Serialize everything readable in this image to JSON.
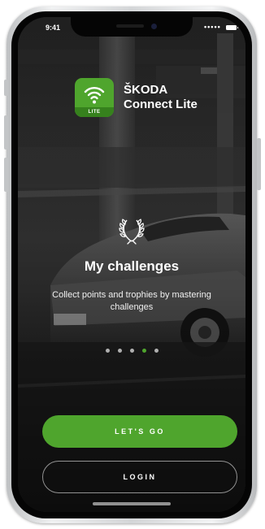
{
  "status_bar": {
    "time": "9:41",
    "signal_dots": "•••••"
  },
  "brand": {
    "name": "ŠKODA",
    "product": "Connect Lite",
    "logo_badge": "LITE",
    "logo_icon": "wifi-signal-icon",
    "accent_color": "#4fa52d"
  },
  "slide": {
    "icon": "laurel-wreath-icon",
    "title": "My challenges",
    "description": "Collect points and trophies by mastering challenges"
  },
  "pager": {
    "total": 5,
    "active_index": 3
  },
  "actions": {
    "primary_label": "LET'S GO",
    "secondary_label": "LOGIN"
  }
}
